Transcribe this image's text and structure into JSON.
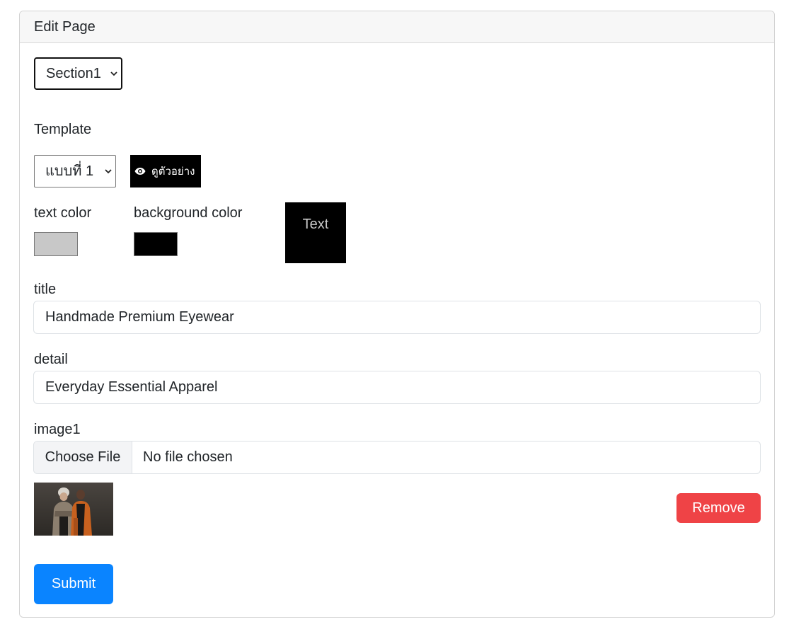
{
  "header": {
    "title": "Edit Page"
  },
  "section_select": {
    "value": "Section1"
  },
  "template": {
    "label": "Template",
    "select_value": "แบบที่ 1",
    "preview_label": "ดูตัวอย่าง"
  },
  "colors": {
    "text_color_label": "text color",
    "background_color_label": "background color",
    "text_color_value": "#c8c8c8",
    "background_color_value": "#000000",
    "preview_text": "Text"
  },
  "title_field": {
    "label": "title",
    "value": "Handmade Premium Eyewear"
  },
  "detail_field": {
    "label": "detail",
    "value": "Everyday Essential Apparel"
  },
  "image_field": {
    "label": "image1",
    "choose_label": "Choose File",
    "status": "No file chosen"
  },
  "actions": {
    "remove_label": "Remove",
    "submit_label": "Submit"
  },
  "icons": {
    "preview_icon": "eye-icon",
    "select_icon": "chevron-down-icon"
  }
}
